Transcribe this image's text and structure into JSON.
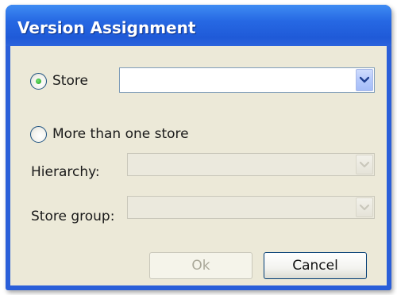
{
  "dialog": {
    "title": "Version Assignment"
  },
  "store_option": {
    "label": "Store",
    "selected": true,
    "value": ""
  },
  "multi_store_option": {
    "label": "More than one store",
    "selected": false
  },
  "hierarchy": {
    "label": "Hierarchy:",
    "value": "",
    "enabled": false
  },
  "store_group": {
    "label": "Store group:",
    "value": "",
    "enabled": false
  },
  "buttons": {
    "ok_label": "Ok",
    "ok_enabled": false,
    "cancel_label": "Cancel"
  },
  "icons": {
    "dropdown": "chevron-down-icon",
    "radio": "radio-button"
  },
  "colors": {
    "titlebar": "#2668e3",
    "client_background": "#ece9d8",
    "radio_dot": "#21a121"
  }
}
